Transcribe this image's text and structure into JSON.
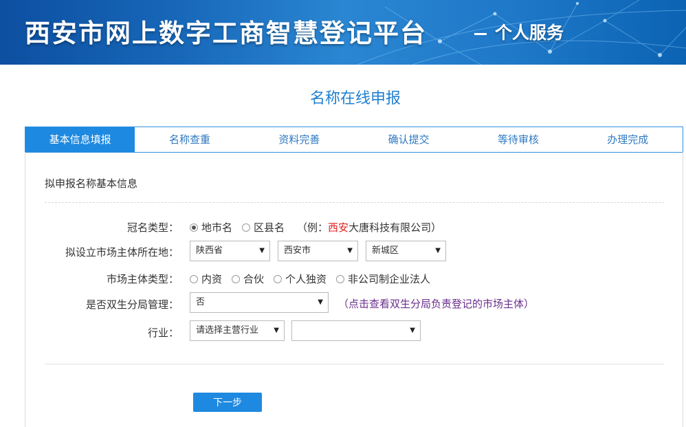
{
  "banner": {
    "title": "西安市网上数字工商智慧登记平台",
    "subtitle": "个人服务"
  },
  "page_title": "名称在线申报",
  "tabs": [
    {
      "label": "基本信息填报",
      "active": true
    },
    {
      "label": "名称查重",
      "active": false
    },
    {
      "label": "资料完善",
      "active": false
    },
    {
      "label": "确认提交",
      "active": false
    },
    {
      "label": "等待审核",
      "active": false
    },
    {
      "label": "办理完成",
      "active": false
    }
  ],
  "section_title": "拟申报名称基本信息",
  "form": {
    "crown_type": {
      "label": "冠名类型：",
      "options": [
        "地市名",
        "区县名"
      ],
      "selected": "地市名",
      "example_prefix": "（例：",
      "example_highlight": "西安",
      "example_suffix": "大唐科技有限公司）"
    },
    "location": {
      "label": "拟设立市场主体所在地：",
      "province": "陕西省",
      "city": "西安市",
      "district": "新城区"
    },
    "entity_type": {
      "label": "市场主体类型：",
      "options": [
        "内资",
        "合伙",
        "个人独资",
        "非公司制企业法人"
      ]
    },
    "dual_management": {
      "label": "是否双生分局管理：",
      "value": "否",
      "link_text": "（点击查看双生分局负责登记的市场主体）"
    },
    "industry": {
      "label": "行业：",
      "main_value": "请选择主营行业",
      "sub_value": ""
    }
  },
  "next_button": "下一步",
  "colors": {
    "accent": "#1e89e0",
    "title_blue": "#1f7fd0",
    "highlight_red": "#e02020",
    "link_purple": "#6a2d8c"
  }
}
